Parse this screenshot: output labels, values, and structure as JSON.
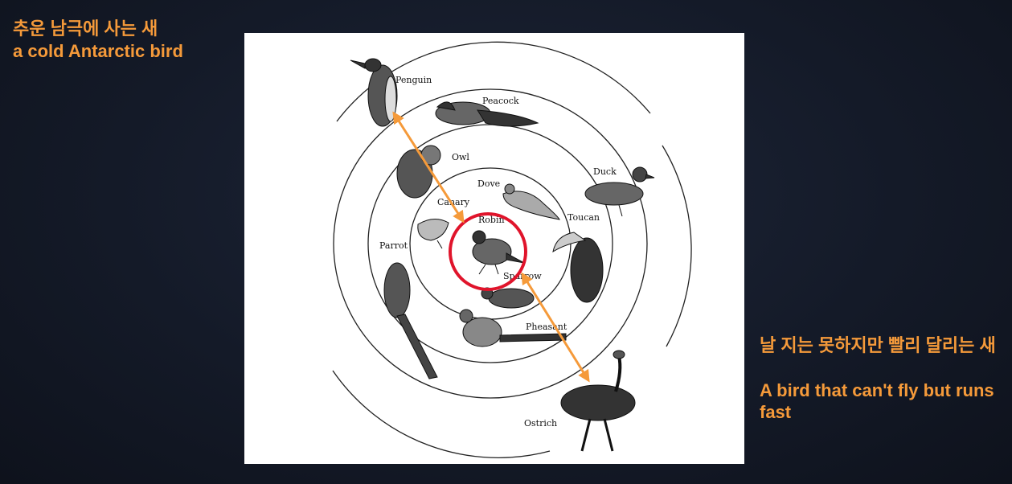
{
  "annotation_left": {
    "korean": "추운 남극에 사는 새",
    "english": "a cold Antarctic bird"
  },
  "annotation_right": {
    "korean": "날 지는 못하지만 빨리 달리는 새",
    "english": "A bird that can't fly but runs fast"
  },
  "diagram": {
    "center_bird": "Robin",
    "birds": [
      "Penguin",
      "Peacock",
      "Owl",
      "Dove",
      "Canary",
      "Duck",
      "Toucan",
      "Parrot",
      "Sparrow",
      "Pheasant",
      "Ostrich"
    ]
  },
  "colors": {
    "accent_orange": "#f59a3a",
    "highlight_red": "#e0142b",
    "background_navy": "#141a28"
  }
}
